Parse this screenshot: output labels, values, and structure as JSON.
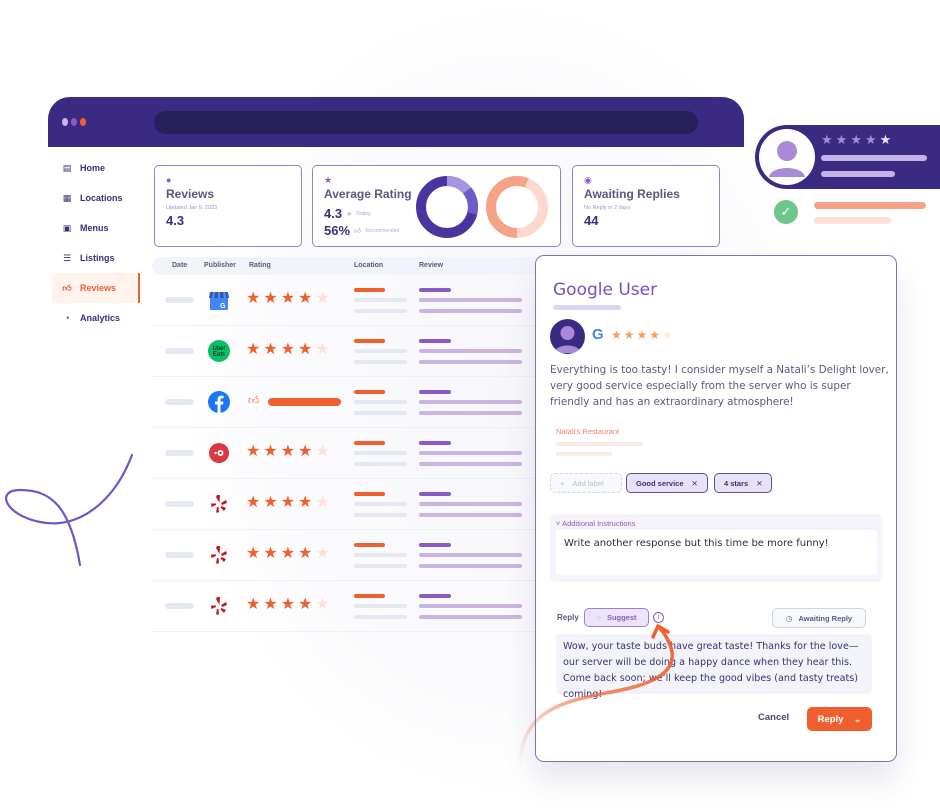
{
  "window": {
    "traffic_dots": [
      "#c5b7ea",
      "#8a5ac8",
      "#f0602e"
    ],
    "url": ""
  },
  "sidebar": {
    "items": [
      {
        "label": "Home",
        "icon": "document-icon",
        "active": false
      },
      {
        "label": "Locations",
        "icon": "store-icon",
        "active": false
      },
      {
        "label": "Menus",
        "icon": "menu-icon",
        "active": false
      },
      {
        "label": "Listings",
        "icon": "list-icon",
        "active": false
      },
      {
        "label": "Reviews",
        "icon": "thumbs-up-icon",
        "active": true
      },
      {
        "label": "Analytics",
        "icon": "pie-chart-icon",
        "active": false
      }
    ]
  },
  "cards": {
    "reviews": {
      "title": "Reviews",
      "subtitle": "Updated Jan 9, 2023",
      "value": "4.3"
    },
    "average_rating": {
      "title": "Average Rating",
      "rating_value": "4.3",
      "rating_label": "Rating",
      "recommended_value": "56%",
      "recommended_label": "Recommended",
      "rating_donut_fill": 0.86,
      "recommended_donut_fill": 0.56
    },
    "awaiting": {
      "title": "Awaiting Replies",
      "subtitle": "No Reply in 2 days",
      "value": "44"
    }
  },
  "table": {
    "headers": [
      "Date",
      "Publisher",
      "Rating",
      "Location",
      "Review"
    ],
    "rows": [
      {
        "publisher": "Google Business",
        "rating_type": "stars",
        "rating": 4
      },
      {
        "publisher": "Uber Eats",
        "rating_type": "stars",
        "rating": 4
      },
      {
        "publisher": "Facebook",
        "rating_type": "recommend",
        "rating": 1
      },
      {
        "publisher": "OpenTable",
        "rating_type": "stars",
        "rating": 4
      },
      {
        "publisher": "Yelp",
        "rating_type": "stars",
        "rating": 4
      },
      {
        "publisher": "Yelp",
        "rating_type": "stars",
        "rating": 4
      },
      {
        "publisher": "Yelp",
        "rating_type": "stars",
        "rating": 4
      }
    ],
    "uber_logo_text": [
      "Uber",
      "Eats"
    ]
  },
  "notification": {
    "stars": 5
  },
  "review_panel": {
    "user_name": "Google User",
    "source_icon": "G",
    "rating": 4,
    "review_text": "Everything is too tasty! I consider myself a Natali’s Delight lover, very good service especially from the server who is super friendly and has an extraordinary atmosphere!",
    "restaurant": "Natali's Restaurant",
    "add_label": "Add label",
    "tags": [
      "Good service",
      "4 stars"
    ],
    "instructions_label": "Additional Instructions",
    "instructions_text": "Write another response but this time be more funny!",
    "reply_label": "Reply",
    "suggest_label": "Suggest",
    "status_label": "Awaiting Reply",
    "reply_text": "Wow, your taste buds have great taste! Thanks for the love—our server will be doing a happy dance when they hear this. Come back soon; we’ll keep the good vibes (and tasty treats) coming!",
    "cancel_label": "Cancel",
    "submit_label": "Reply"
  },
  "colors": {
    "brand": "#3b2a82",
    "accent": "#f0602e",
    "purple": "#8a5ac8"
  }
}
